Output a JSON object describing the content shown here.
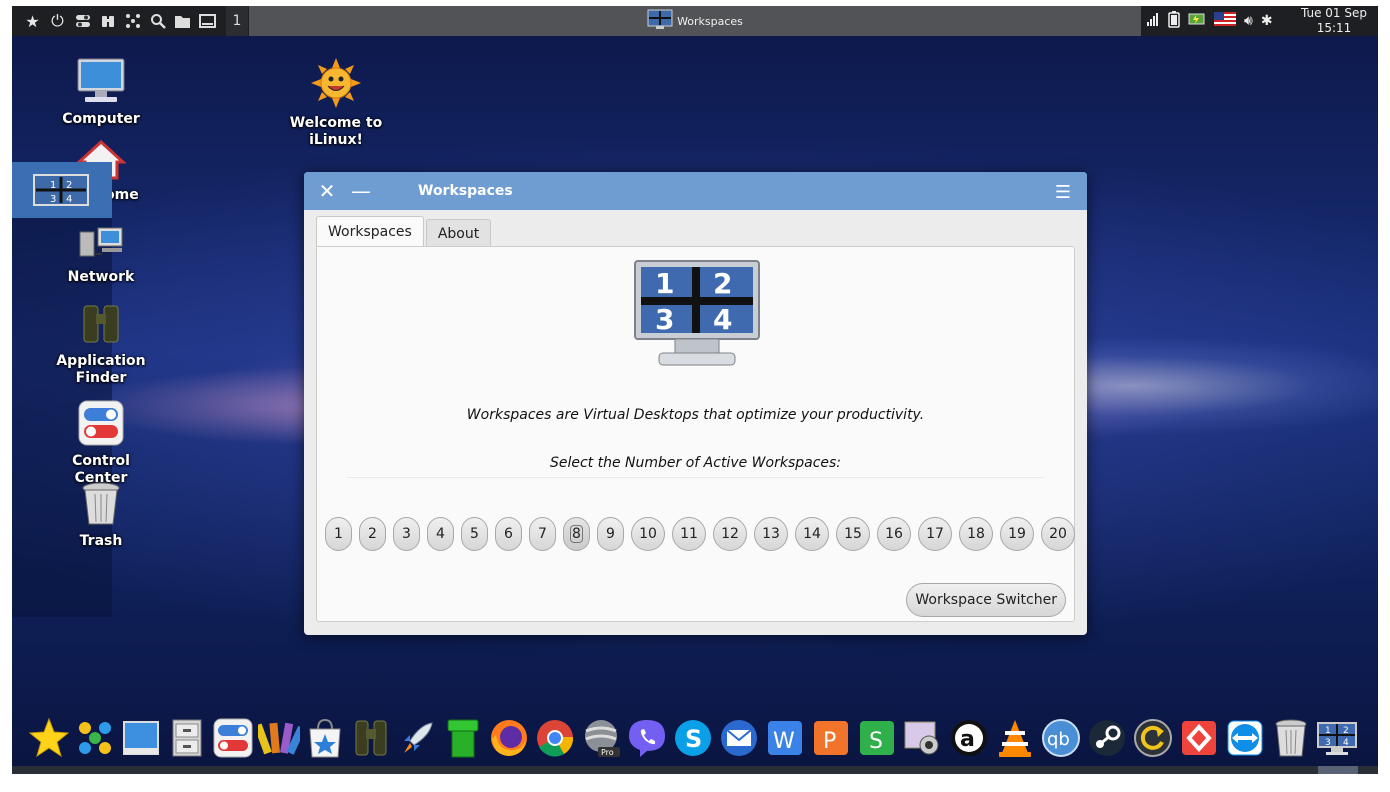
{
  "top_panel": {
    "workspace_number": "1",
    "task_title": "Workspaces",
    "clock_date": "Tue 01 Sep",
    "clock_time": "15:11",
    "launcher_icons": [
      "star-icon",
      "power-icon",
      "settings-toggle-icon",
      "binoculars-icon",
      "apps-grid-icon",
      "search-icon",
      "folder-icon",
      "show-desktop-icon"
    ],
    "tray_icons": [
      "signal-icon",
      "battery-icon",
      "power-manager-icon",
      "us-flag-icon",
      "volume-icon",
      "bluetooth-icon"
    ]
  },
  "desktop": {
    "icons": [
      {
        "label": "Computer"
      },
      {
        "label": "Home"
      },
      {
        "label": "Network"
      },
      {
        "label": "Application Finder"
      },
      {
        "label": "Control Center"
      },
      {
        "label": "Trash"
      },
      {
        "label": "Welcome to iLinux!"
      }
    ]
  },
  "window": {
    "title": "Workspaces",
    "tabs": [
      {
        "label": "Workspaces",
        "active": true
      },
      {
        "label": "About",
        "active": false
      }
    ],
    "logo_digits": [
      "1",
      "2",
      "3",
      "4"
    ],
    "description": "Workspaces are Virtual Desktops that optimize your productivity.",
    "prompt": "Select the Number of Active Workspaces:",
    "numbers": [
      "1",
      "2",
      "3",
      "4",
      "5",
      "6",
      "7",
      "8",
      "9",
      "10",
      "11",
      "12",
      "13",
      "14",
      "15",
      "16",
      "17",
      "18",
      "19",
      "20"
    ],
    "selected_number": "8",
    "switcher_label": "Workspace Switcher"
  },
  "dock": {
    "items": [
      "favorites-star-icon",
      "app-dots-icon",
      "desktop-icon",
      "file-cabinet-icon",
      "control-center-icon",
      "color-palette-icon",
      "software-store-icon",
      "binoculars-icon",
      "rocket-icon",
      "green-pipe-icon",
      "firefox-icon",
      "chrome-icon",
      "google-earth-pro-icon",
      "viber-icon",
      "skype-icon",
      "mail-icon",
      "wps-writer-icon",
      "wps-presentation-icon",
      "wps-spreadsheet-icon",
      "webcam-icon",
      "amarok-icon",
      "vlc-icon",
      "qbittorrent-icon",
      "steam-icon",
      "timeshift-icon",
      "anydesk-icon",
      "teamviewer-icon",
      "trash-icon",
      "workspaces-icon"
    ],
    "pro_badge": "Pro",
    "workspace_digits": [
      "1",
      "2",
      "3",
      "4"
    ]
  },
  "colors": {
    "titlebar": "#6f9dd1",
    "selection": "#3b6fb3",
    "panel_bg": "#1d1f22"
  }
}
